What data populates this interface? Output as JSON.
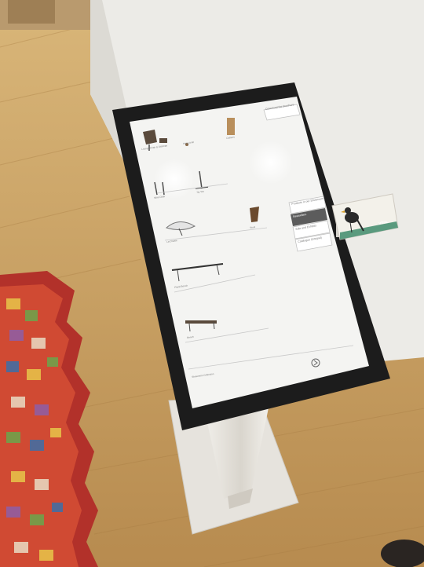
{
  "scene": {
    "description_free": true,
    "colors": {
      "wall": "#e9e7e3",
      "floor": "#c9a46a",
      "bezel": "#1c1c1c",
      "screen": "#f4f4f2",
      "stand": "#e2dfd8",
      "rug_red": "#c0392b",
      "card": "#f3f1ea"
    }
  },
  "kiosk_ui": {
    "top_button": "Download the Brochure",
    "menu": [
      "Products in our Showroom",
      "Bestsellers",
      "Sale and Exhibits",
      "Catalogue (Integral)"
    ],
    "products": [
      {
        "name": "Lounge Chair & Ottoman",
        "icon": "lounge-chair-icon"
      },
      {
        "name": "Hang It All",
        "icon": "coat-rack-icon"
      },
      {
        "name": "Cabinet",
        "icon": "cabinet-icon"
      },
      {
        "name": "Wire Chair",
        "icon": "wire-chair-icon"
      },
      {
        "name": "Tip Ton",
        "icon": "stool-icon"
      },
      {
        "name": "La Chaise",
        "icon": "la-chaise-icon"
      },
      {
        "name": "Stool",
        "icon": "wood-stool-icon"
      },
      {
        "name": "Plank Bench",
        "icon": "table-icon"
      },
      {
        "name": "Bench",
        "icon": "bench-icon"
      }
    ],
    "footer_text": "Showroom Collection",
    "footer_arrow_icon": "chevron-right-icon"
  },
  "card": {
    "brand": "vitra.",
    "icon": "bird-icon"
  }
}
